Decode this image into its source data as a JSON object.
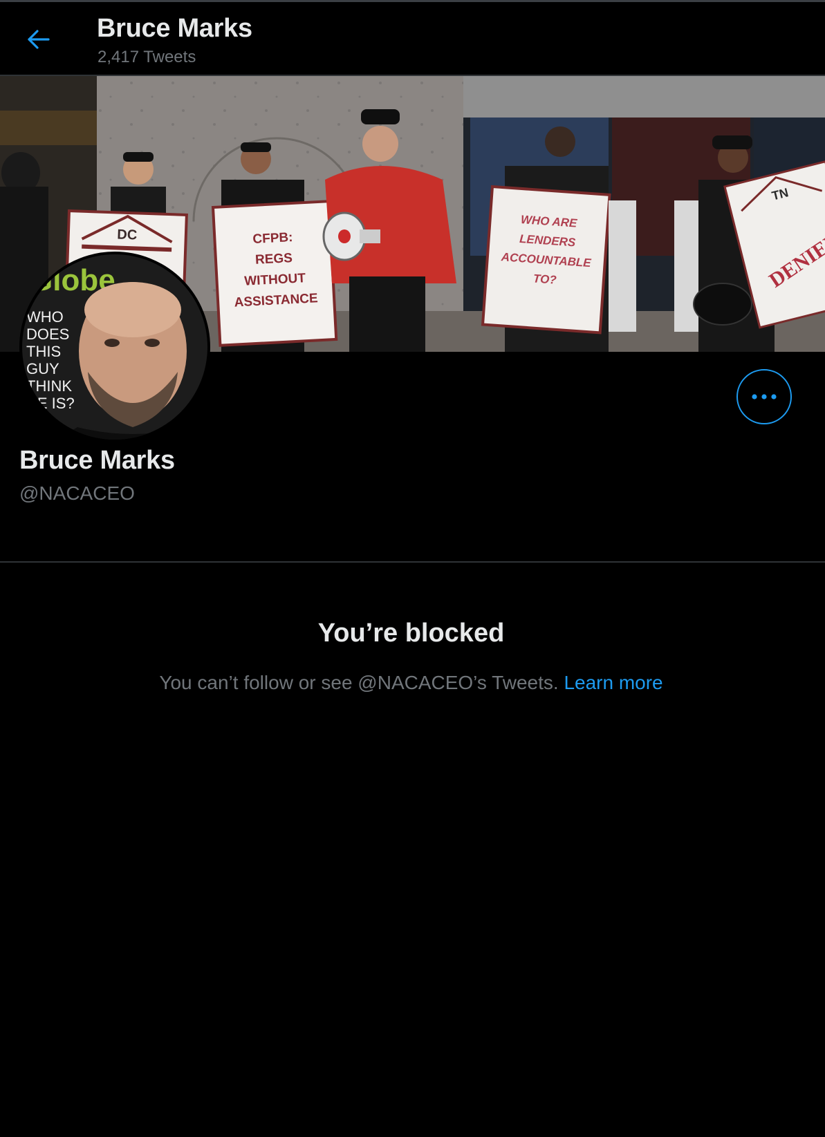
{
  "header": {
    "back_icon": "arrow-left-icon",
    "title": "Bruce Marks",
    "tweet_count": "2,417 Tweets"
  },
  "banner": {
    "signs": {
      "dc": "DC",
      "cfpb_line1": "CFPB:",
      "cfpb_line2": "REGS",
      "cfpb_line3": "WITHOUT",
      "cfpb_line4": "ASSISTANCE",
      "who_line1": "WHO ARE",
      "who_line2": "LENDERS",
      "who_line3": "ACCOUNTABLE",
      "who_line4": "TO?",
      "tn": "TN",
      "denied": "DENIED"
    }
  },
  "avatar": {
    "magazine_masthead": "Globe",
    "cover_line1": "WHO",
    "cover_line2": "DOES",
    "cover_line3": "THIS",
    "cover_line4": "GUY",
    "cover_line5": "THINK",
    "cover_line6": "HE IS?"
  },
  "profile": {
    "name": "Bruce Marks",
    "handle": "@NACACEO",
    "more_icon": "more-horizontal-icon"
  },
  "blocked": {
    "title": "You’re blocked",
    "message": "You can’t follow or see @NACACEO’s Tweets.",
    "learn_more": "Learn more"
  },
  "colors": {
    "background": "#000000",
    "accent": "#1d9bf0",
    "primary_text": "#e7e9ea",
    "secondary_text": "#71767b",
    "divider": "#2f3336"
  }
}
